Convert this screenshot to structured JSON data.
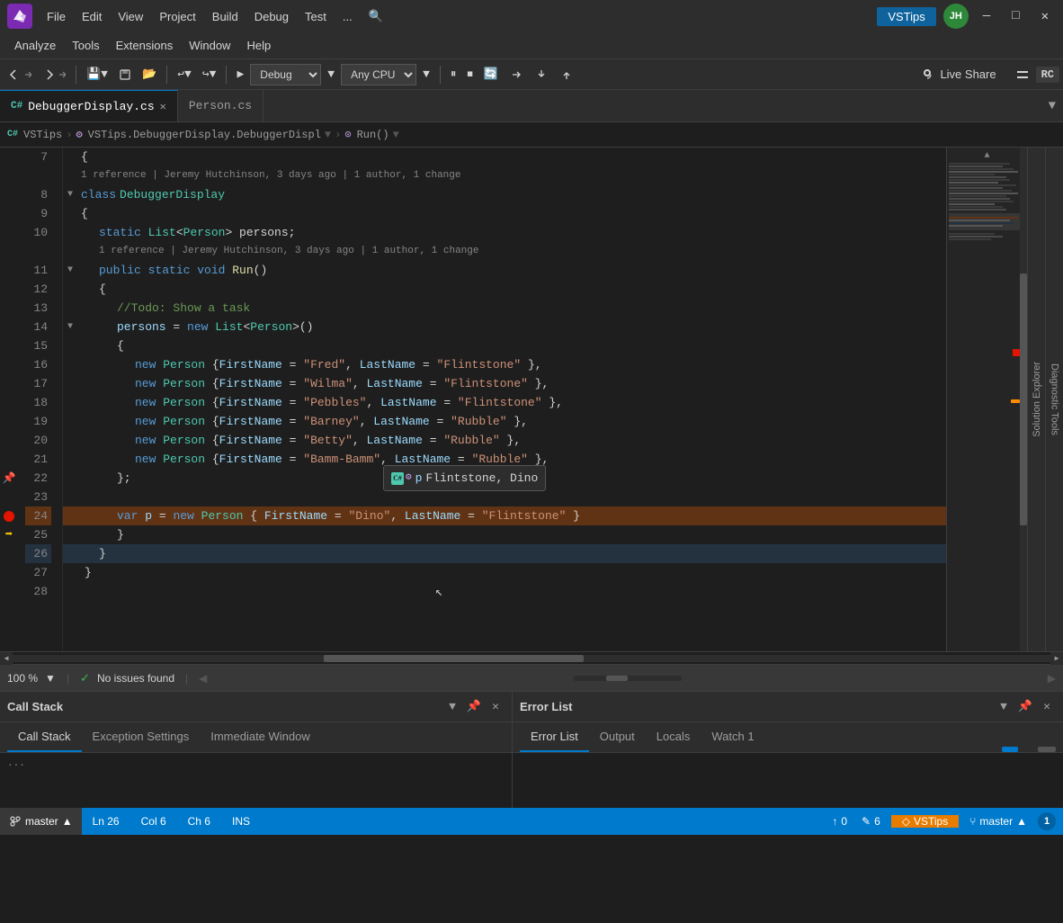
{
  "window": {
    "title": "VSTips",
    "minimize": "—",
    "maximize": "□",
    "close": "✕"
  },
  "user": {
    "initials": "JH"
  },
  "menu": {
    "items": [
      "File",
      "Edit",
      "View",
      "Project",
      "Build",
      "Debug",
      "Test",
      "...",
      "🔍"
    ]
  },
  "menu2": {
    "items": [
      "Analyze",
      "Tools",
      "Extensions",
      "Window",
      "Help"
    ]
  },
  "toolbar": {
    "debug_config": "Debug",
    "platform": "Any CPU",
    "live_share": "Live Share"
  },
  "tabs": {
    "active": "DebuggerDisplay.cs",
    "inactive": "Person.cs",
    "dropdown": "▼"
  },
  "breadcrumb": {
    "project": "VSTips",
    "class": "VSTips.DebuggerDisplay.DebuggerDispl",
    "method": "Run()"
  },
  "code": {
    "lines": [
      {
        "num": 7,
        "text": "        {",
        "indent": 0
      },
      {
        "num": 8,
        "text": "            class DebuggerDisplay",
        "indent": 0
      },
      {
        "num": 9,
        "text": "            {",
        "indent": 0
      },
      {
        "num": 10,
        "text": "                static List<Person> persons;",
        "indent": 0
      },
      {
        "num": 11,
        "text": "                public static void Run()",
        "indent": 0
      },
      {
        "num": 12,
        "text": "                {",
        "indent": 0
      },
      {
        "num": 13,
        "text": "                    //Todo: Show a task",
        "indent": 0
      },
      {
        "num": 14,
        "text": "                    persons = new List<Person>()",
        "indent": 0
      },
      {
        "num": 15,
        "text": "                    {",
        "indent": 0
      },
      {
        "num": 16,
        "text": "                        new Person {FirstName = \"Fred\", LastName = \"Flintstone\" },",
        "indent": 0
      },
      {
        "num": 17,
        "text": "                        new Person {FirstName = \"Wilma\", LastName = \"Flintstone\" },",
        "indent": 0
      },
      {
        "num": 18,
        "text": "                        new Person {FirstName = \"Pebbles\", LastName = \"Flintstone\" },",
        "indent": 0
      },
      {
        "num": 19,
        "text": "                        new Person {FirstName = \"Barney\", LastName = \"Rubble\" },",
        "indent": 0
      },
      {
        "num": 20,
        "text": "                        new Person {FirstName = \"Betty\", LastName = \"Rubble\" },",
        "indent": 0
      },
      {
        "num": 21,
        "text": "                        new Person {FirstName = \"Bamm-Bamm\", LastName = \"Rubble\" },",
        "indent": 0
      },
      {
        "num": 22,
        "text": "                    };",
        "indent": 0
      },
      {
        "num": 23,
        "text": "",
        "indent": 0
      },
      {
        "num": 24,
        "text": "                    var p = new Person { FirstName = \"Dino\", LastName = \"Flintstone\" }",
        "indent": 0,
        "highlighted": true
      },
      {
        "num": 25,
        "text": "                    }",
        "indent": 0
      },
      {
        "num": 26,
        "text": "                }",
        "indent": 0
      },
      {
        "num": 27,
        "text": "            }",
        "indent": 0
      },
      {
        "num": 28,
        "text": "",
        "indent": 0
      }
    ],
    "reference1": "1 reference | Jeremy Hutchinson, 3 days ago | 1 author, 1 change",
    "reference2": "1 reference | Jeremy Hutchinson, 3 days ago | 1 author, 1 change"
  },
  "datatip": {
    "variable": "p",
    "value": "Flintstone, Dino"
  },
  "bottom_panels": {
    "left": {
      "title": "Call Stack",
      "tabs": [
        "Call Stack",
        "Exception Settings",
        "Immediate Window"
      ]
    },
    "right": {
      "title": "Error List",
      "tabs": [
        "Error List",
        "Output",
        "Locals",
        "Watch 1"
      ]
    }
  },
  "status_bar": {
    "zoom": "100 %",
    "issues": "No issues found",
    "line": "Ln 26",
    "col": "Col 6",
    "ch": "Ch 6",
    "ins": "INS",
    "errors": "0",
    "warnings": "6",
    "vstips": "VSTips",
    "branch": "master",
    "notifications": "1"
  }
}
